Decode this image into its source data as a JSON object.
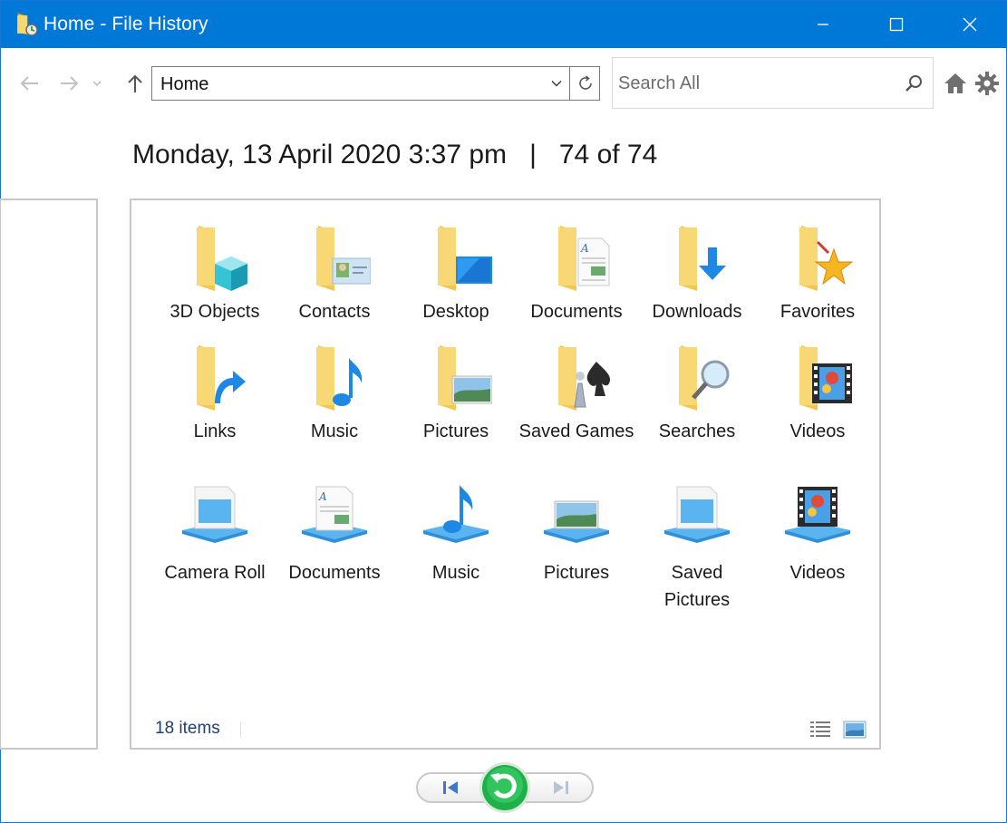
{
  "window": {
    "title": "Home - File History"
  },
  "toolbar": {
    "address": "Home",
    "search_placeholder": "Search All"
  },
  "snapshot": {
    "date": "Monday, 13 April 2020 3:37 pm",
    "separator": "|",
    "position": "74 of 74"
  },
  "items": [
    {
      "label": "3D Objects",
      "icon": "folder-3d-objects-icon"
    },
    {
      "label": "Contacts",
      "icon": "folder-contacts-icon"
    },
    {
      "label": "Desktop",
      "icon": "folder-desktop-icon"
    },
    {
      "label": "Documents",
      "icon": "folder-documents-icon"
    },
    {
      "label": "Downloads",
      "icon": "folder-downloads-icon"
    },
    {
      "label": "Favorites",
      "icon": "folder-favorites-icon"
    },
    {
      "label": "Links",
      "icon": "folder-links-icon"
    },
    {
      "label": "Music",
      "icon": "folder-music-icon"
    },
    {
      "label": "Pictures",
      "icon": "folder-pictures-icon"
    },
    {
      "label": "Saved Games",
      "icon": "folder-saved-games-icon"
    },
    {
      "label": "Searches",
      "icon": "folder-searches-icon"
    },
    {
      "label": "Videos",
      "icon": "folder-videos-icon"
    },
    {
      "label": "Camera Roll",
      "icon": "library-camera-roll-icon"
    },
    {
      "label": "Documents",
      "icon": "library-documents-icon"
    },
    {
      "label": "Music",
      "icon": "library-music-icon"
    },
    {
      "label": "Pictures",
      "icon": "library-pictures-icon"
    },
    {
      "label": "Saved Pictures",
      "icon": "library-saved-pictures-icon"
    },
    {
      "label": "Videos",
      "icon": "library-videos-icon"
    }
  ],
  "status": {
    "count": "18 items"
  },
  "colors": {
    "titlebar": "#0078d7",
    "folder": "#f8d775",
    "accent_blue": "#1e88e5",
    "restore_green": "#22b14c"
  }
}
